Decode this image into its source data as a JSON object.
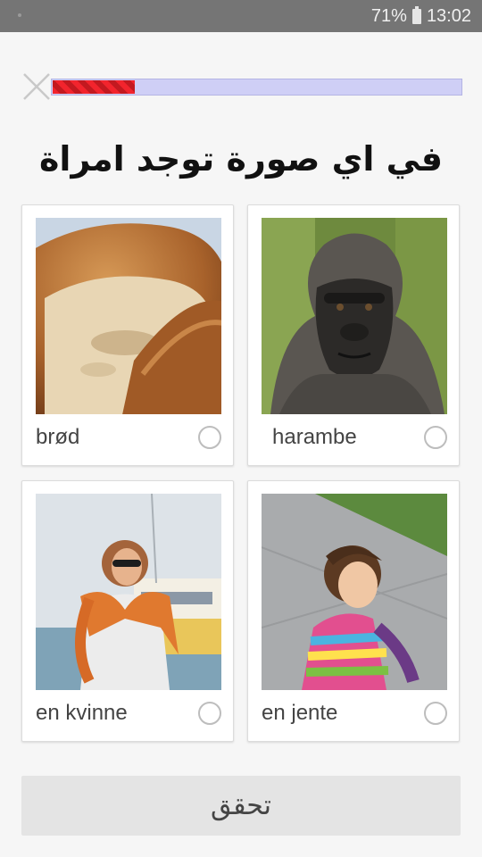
{
  "status_bar": {
    "battery": "71%",
    "time": "13:02",
    "icons": [
      "notification-dot-icon",
      "battery-icon"
    ]
  },
  "toolbar": {
    "close_icon": "close-icon",
    "progress": 0.2
  },
  "question": "في اي صورة توجد امراة",
  "options": [
    {
      "label": "brød",
      "image": "bread-image"
    },
    {
      "label": "harambe",
      "image": "gorilla-image"
    },
    {
      "label": "en kvinne",
      "image": "woman-image"
    },
    {
      "label": "en jente",
      "image": "girl-image"
    }
  ],
  "check_button": {
    "label": "تحقق"
  },
  "colors": {
    "progress_fill": "#f2242d",
    "progress_track": "#cfcff6",
    "status_bar": "#757575"
  }
}
